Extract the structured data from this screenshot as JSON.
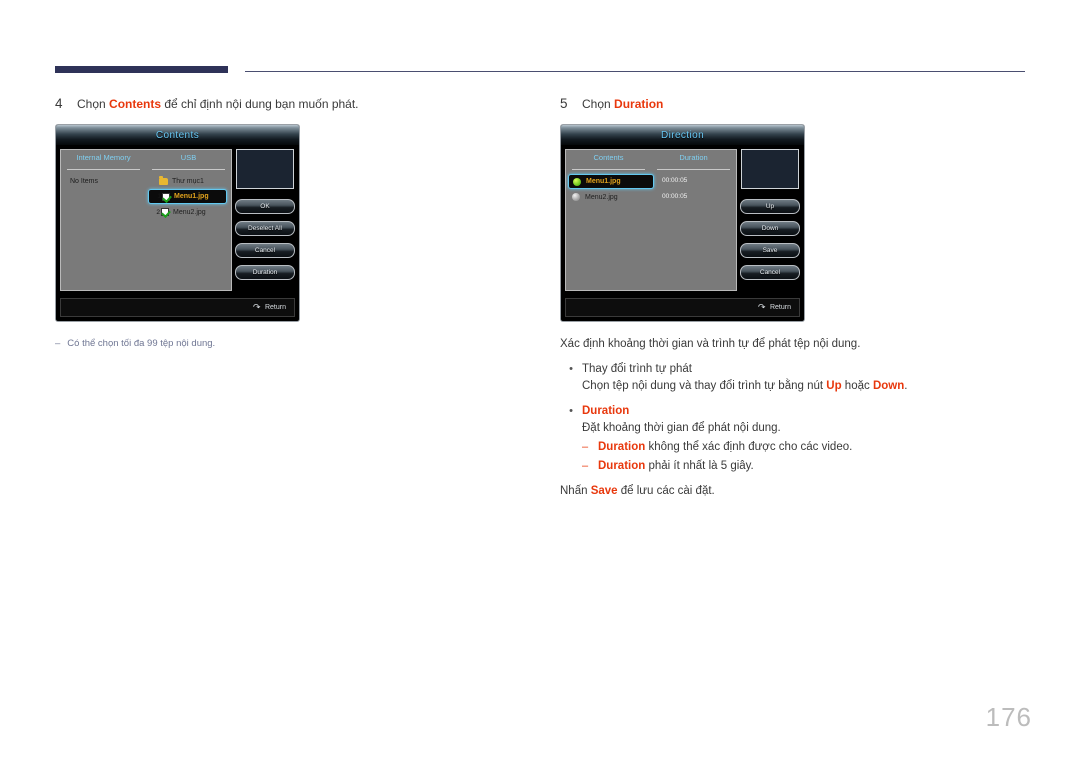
{
  "page": {
    "number": "176",
    "accent_color": "#e8380d",
    "rule_color": "#2e3258"
  },
  "left_column": {
    "step": {
      "number": "4",
      "text_before": "Chọn ",
      "keyword": "Contents",
      "text_after": " để chỉ định nội dung bạn muốn phát."
    },
    "dialog": {
      "title": "Contents",
      "columns": [
        {
          "header": "Internal Memory",
          "empty_label": "No Items"
        },
        {
          "header": "USB"
        }
      ],
      "usb_items": [
        {
          "index": "",
          "type": "folder",
          "name": "Thư mục1"
        },
        {
          "index": "1",
          "type": "checkbox",
          "name": "Menu1.jpg",
          "selected": true
        },
        {
          "index": "2",
          "type": "checkbox",
          "name": "Menu2.jpg",
          "selected": false
        }
      ],
      "buttons": [
        "OK",
        "Deselect All",
        "Cancel",
        "Duration"
      ],
      "footer": {
        "icon": "return-arrow-icon",
        "label": "Return"
      }
    },
    "note": {
      "dash": "–",
      "text": "Có thể chọn tối đa 99 tệp nội dung."
    }
  },
  "right_column": {
    "step": {
      "number": "5",
      "text_before": "Chọn ",
      "keyword": "Duration"
    },
    "dialog": {
      "title": "Direction",
      "columns": [
        {
          "header": "Contents"
        },
        {
          "header": "Duration"
        }
      ],
      "items": [
        {
          "icon": "green-dot-icon",
          "name": "Menu1.jpg",
          "duration": "00:00:05",
          "selected": true
        },
        {
          "icon": "gray-dot-icon",
          "name": "Menu2.jpg",
          "duration": "00:00:05",
          "selected": false
        }
      ],
      "buttons": [
        "Up",
        "Down",
        "Save",
        "Cancel"
      ],
      "footer": {
        "icon": "return-arrow-icon",
        "label": "Return"
      }
    },
    "intro": "Xác định khoảng thời gian và trình tự để phát tệp nội dung.",
    "bullet1": {
      "mark": "•",
      "title": "Thay đổi trình tự phát",
      "desc_before": "Chọn tệp nội dung và thay đổi trình tự bằng nút ",
      "key1": "Up",
      "desc_mid": " hoặc ",
      "key2": "Down",
      "desc_after": "."
    },
    "bullet2": {
      "mark": "•",
      "title": "Duration",
      "desc": "Đặt khoảng thời gian để phát nội dung.",
      "subs": [
        {
          "mark": "–",
          "key": "Duration",
          "text": " không thể xác định được cho các video."
        },
        {
          "mark": "–",
          "key": "Duration",
          "text": " phải ít nhất là 5 giây."
        }
      ]
    },
    "closing": {
      "before": "Nhấn ",
      "key": "Save",
      "after": " để lưu các cài đặt."
    }
  }
}
